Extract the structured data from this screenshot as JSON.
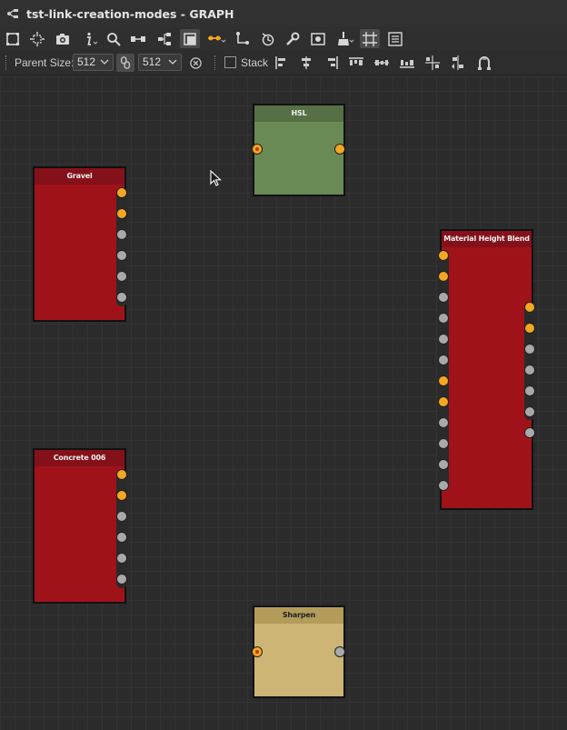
{
  "window": {
    "title": "tst-link-creation-modes - GRAPH"
  },
  "toolbar": {
    "icons": [
      "frame-icon",
      "fit-view-icon",
      "camera-icon",
      "info-icon",
      "search-icon",
      "node-link-icon",
      "hierarchy-icon",
      "display-mode-icon",
      "link-style-icon",
      "connector-icon",
      "history-icon",
      "tools-icon",
      "preview-icon",
      "clean-icon",
      "snap-grid-icon",
      "list-icon"
    ]
  },
  "options_bar": {
    "parent_size_label": "Parent Size:",
    "size_x": "512",
    "size_y": "512",
    "stack_label": "Stack",
    "stack_checked": false
  },
  "nodes": {
    "hsl": {
      "title": "HSL"
    },
    "gravel": {
      "title": "Gravel"
    },
    "material_height_blend": {
      "title": "Material Height Blend"
    },
    "concrete": {
      "title": "Concrete 006"
    },
    "sharpen": {
      "title": "Sharpen"
    }
  },
  "colors": {
    "node_red": "#a01219",
    "node_green": "#6a8a55",
    "node_tan": "#cdb576",
    "port_orange": "#f5a623",
    "port_grey": "#a9a9a9",
    "canvas": "#2b2b2b"
  }
}
